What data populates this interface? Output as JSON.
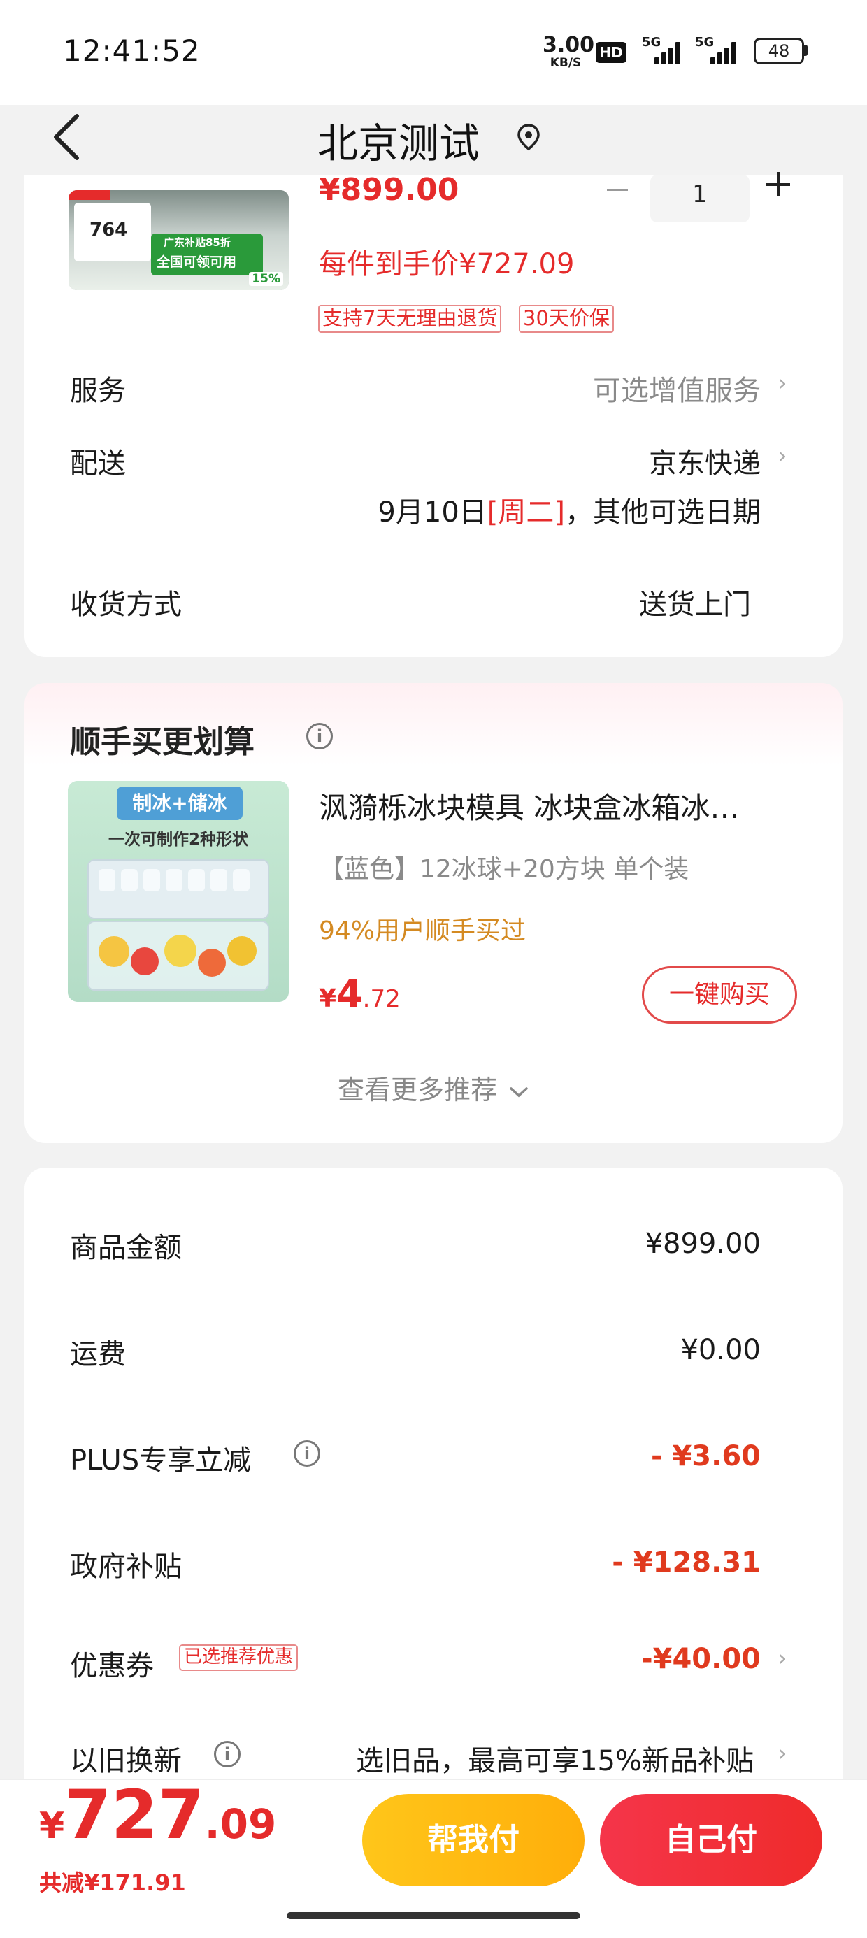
{
  "status_bar": {
    "time": "12:41:52",
    "net_speed_value": "3.00",
    "net_speed_unit": "KB/S",
    "hd_label": "HD",
    "signal1_label": "5G",
    "signal2_label": "5G",
    "battery": "48"
  },
  "header": {
    "title": "北京测试",
    "back_icon": "chevron-left-icon",
    "location_icon": "location-pin-icon"
  },
  "product": {
    "thumb_price": "764",
    "thumb_badge": "广东补贴85折",
    "thumb_promo": "全国可领可用",
    "thumb_pct": "15%",
    "price": "¥899.00",
    "quantity": "1",
    "hand_price": "每件到手价¥727.09",
    "tags": [
      "支持7天无理由退货",
      "30天价保"
    ]
  },
  "service": {
    "label": "服务",
    "value": "可选增值服务"
  },
  "delivery": {
    "label": "配送",
    "carrier": "京东快递",
    "date": "9月10日",
    "weekday": "[周二]",
    "date_suffix": "，其他可选日期"
  },
  "receive": {
    "label": "收货方式",
    "value": "送货上门"
  },
  "upsell": {
    "title": "顺手买更划算",
    "image_line1": "制冰+储冰",
    "image_line2": "一次可制作2种形状",
    "name": "沨漪栎冰块模具 冰块盒冰箱冰…",
    "spec": "【蓝色】12冰球+20方块 单个装",
    "social": "94%用户顺手买过",
    "price_currency": "¥",
    "price_int": "4",
    "price_dec": ".72",
    "buy_label": "一键购买",
    "more_label": "查看更多推荐"
  },
  "summary": {
    "goods_label": "商品金额",
    "goods_value": "¥899.00",
    "shipping_label": "运费",
    "shipping_value": "¥0.00",
    "plus_label": "PLUS专享立减",
    "plus_value": "- ¥3.60",
    "gov_label": "政府补贴",
    "gov_value": "- ¥128.31",
    "coupon_label": "优惠券",
    "coupon_badge": "已选推荐优惠",
    "coupon_value": "-¥40.00",
    "tradein_label": "以旧换新",
    "tradein_value": "选旧品，最高可享15%新品补贴"
  },
  "footer": {
    "currency": "¥",
    "total_int": "727",
    "total_dec": ".09",
    "saved": "共减¥171.91",
    "help_pay_label": "帮我付",
    "self_pay_label": "自己付"
  },
  "colors": {
    "accent_red": "#e52b2b",
    "help_pay_yellow": "#ffb70f",
    "social_orange": "#d48a22"
  }
}
